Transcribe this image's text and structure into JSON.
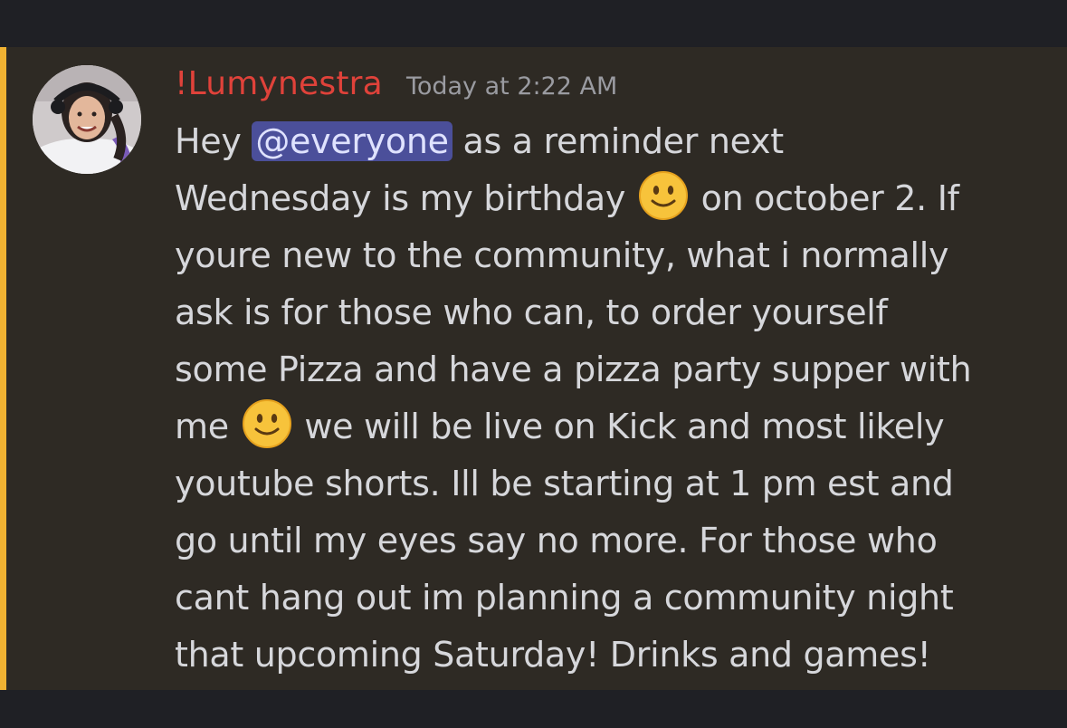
{
  "message": {
    "author": "!Lumynestra",
    "timestamp": "Today at 2:22 AM",
    "lines": [
      {
        "before": "Hey ",
        "mention": "@everyone",
        "after": " as a reminder next"
      },
      {
        "before": "Wednesday is my birthday ",
        "emoji": "slightly-smiling-face",
        "after": " on october 2. If"
      },
      {
        "text": "youre new to the community, what i normally"
      },
      {
        "text": "ask is for those who can, to order yourself"
      },
      {
        "text": "some Pizza and have a pizza party supper with"
      },
      {
        "before": "me ",
        "emoji": "slightly-smiling-face",
        "after": " we will be live on Kick and most likely"
      },
      {
        "text": "youtube shorts. Ill be starting at 1 pm est and"
      },
      {
        "text": "go until my eyes say no more. For those who"
      },
      {
        "text": "cant hang out im planning a community night"
      },
      {
        "text": "that upcoming Saturday! Drinks and games!"
      }
    ]
  },
  "colors": {
    "author": "#e0423a",
    "mention_highlight_bar": "#f0b232",
    "mention_bg": "#4b4f9a",
    "message_bg": "#2e2a24"
  }
}
